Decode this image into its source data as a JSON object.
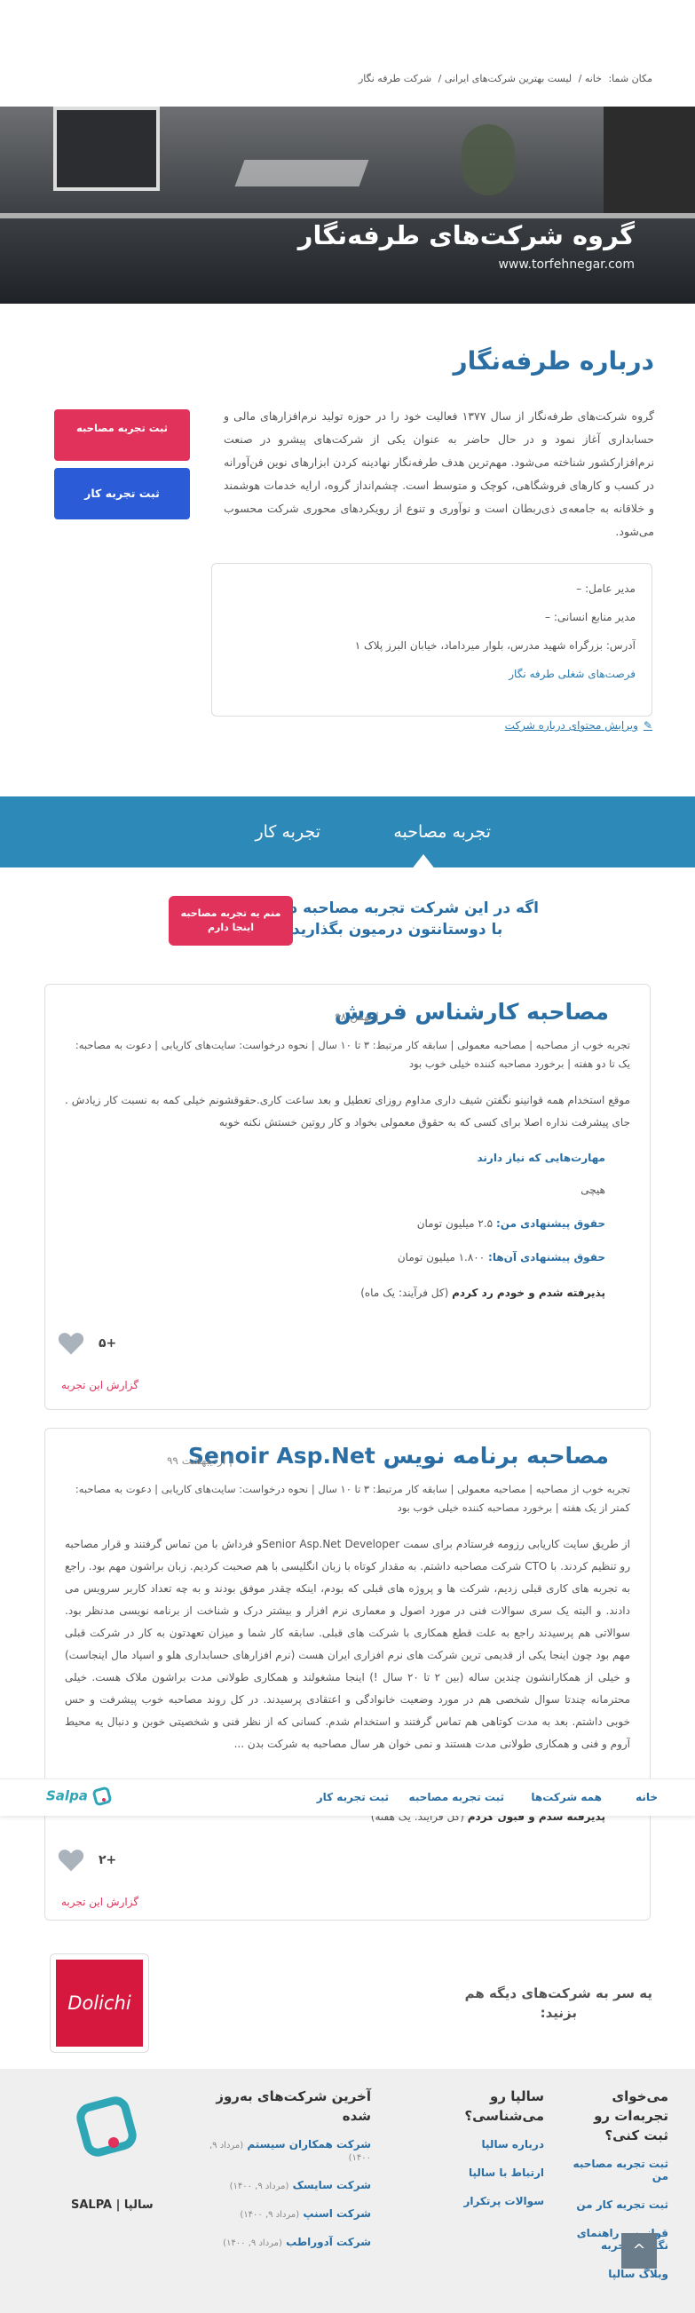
{
  "breadcrumb": {
    "prefix": "مکان شما:",
    "home": "خانه",
    "list": "لیست بهترین شرکت‌های ایرانی",
    "current": "شرکت طرفه نگار",
    "sep": "/"
  },
  "hero": {
    "title": "گروه شرکت‌های طرفه‌نگار",
    "website": "www.torfehnegar.com"
  },
  "about": {
    "title": "درباره طرفه‌نگار",
    "text": "گروه شرکت‌های طرفه‌نگار از سال ۱۳۷۷ فعالیت خود را در حوزه تولید نرم‌افزارهای مالی و حسابداری آغاز نمود و در حال حاضر به عنوان یکی از شرکت‌های پیشرو در صنعت نرم‌افزارکشور شناخته می‌شود. مهم‌ترین هدف طرفه‌نگار نهادینه کردن ابزارهای نوین فن‌آورانه در کسب و کارهای فروشگاهی، کوچک و متوسط است. چشم‌انداز گروه، ارایه خدمات هوشمند و خلاقانه به جامعه‌ی ذی‌ربطان است و نوآوری و تنوع از رویکردهای محوری شرکت محسوب می‌شود."
  },
  "buttons": {
    "add_interview": "ثبت تجربه مصاحبه",
    "add_work": "ثبت تجربه کار"
  },
  "info": {
    "ceo": "مدیر عامل: –",
    "hr": "مدیر منابع انسانی: –",
    "address": "آدرس: بزرگراه شهید مدرس، بلوار میرداماد، خیابان البرز پلاک ۱",
    "jobs": "فرصت‌های شغلی طرفه نگار",
    "edit": "ویرایش محتوای درباره شرکت"
  },
  "tabs": {
    "interview": "تجربه مصاحبه",
    "work": "تجربه کار"
  },
  "cta": {
    "line1": "اگه در این شرکت تجربه مصاحبه دارید،",
    "line2": "با دوستانتون درمیون بگذارید",
    "button": "منم یه تجربه مصاحبه اینجا دارم"
  },
  "reviews": [
    {
      "title": "مصاحبه کارشناس فروش",
      "date": "| بهمن ۹۸",
      "meta": "تجربه خوب از مصاحبه | مصاحبه معمولی | سابقه کار مرتبط: ۳ تا ۱۰ سال | نحوه درخواست: سایت‌های کاریابی | دعوت به مصاحبه: یک تا دو هفته | برخورد مصاحبه کننده خیلی خوب بود",
      "desc": "موقع استخدام همه قوانینو نگفتن شیف داری مداوم روزای تعطیل و بعد ساعت کاری.حقوقشونم خیلی کمه به نسبت کار زیادش . جای پیشرفت نداره اصلا برای کسی که به حقوق معمولی بخواد و کار روتین خستش نکنه خوبه",
      "skills_label": "مهارت‌هایی که نیاز دارند",
      "skills_value": "هیچی",
      "offer_label": "حقوق پیشنهادی من:",
      "offer_value": "۲.۵ میلیون تومان",
      "their_label": "حقوق پیشنهادی آن‌ها:",
      "their_value": "۱.۸۰۰ میلیون تومان",
      "result_label": "پذیرفته شدم و خودم رد کردم",
      "result_note": "(کل فرآیند: یک ماه)",
      "likes": "+۵",
      "report": "گزارش این تجربه"
    },
    {
      "title": "مصاحبه برنامه نویس Senoir Asp.Net",
      "date": "| اردیبهشت ۹۹",
      "meta": "تجربه خوب از مصاحبه | مصاحبه معمولی | سابقه کار مرتبط: ۳ تا ۱۰ سال | نحوه درخواست: سایت‌های کاریابی | دعوت به مصاحبه: کمتر از یک هفته | برخورد مصاحبه کننده خیلی خوب بود",
      "desc": "از طریق سایت کاریابی رزومه فرستادم برای سمت Senior Asp.Net Developerو فرداش با من تماس گرفتند و قرار مصاحبه رو تنظیم کردند. با CTO شرکت مصاحبه داشتم. به مقدار کوتاه با زبان انگلیسی با هم صحبت کردیم. زبان براشون مهم بود. راجع به تجربه های کاری قبلی زدیم، شرکت ها و پروژه های قبلی که بودم، اینکه چقدر موفق بودند و به چه تعداد کاربر سرویس می دادند. و البته یک سری سوالات فنی در مورد اصول و معماری نرم افزار و بیشتر درک و شناخت از برنامه نویسی مدنظر بود. سوالاتی هم پرسیدند راجع به علت قطع همکاری با شرکت های قبلی. سابقه کار شما و میزان تعهدتون به کار در شرکت قبلی مهم بود چون اینجا یکی از قدیمی ترین شرکت های نرم افزاری ایران هست (نرم افزارهای حسابداری هلو و اسپاد مال اینجاست) و خیلی از همکارانشون چندین ساله (بین ۲ تا ۲۰ سال !) اینجا مشغولند و همکاری طولانی مدت براشون ملاک هست. خیلی محترمانه چندتا سوال شخصی هم در مورد وضعیت خانوادگی و اعتقادی پرسیدند. در کل روند مصاحبه خوب پیشرفت و حس خوبی داشتم. بعد به مدت کوتاهی هم تماس گرفتند و استخدام شدم. کسانی که از نظر فنی و شخصیتی خوبن و دنبال یه محیط آروم و فنی و همکاری طولانی مدت هستند و نمی خوان هر سال مصاحبه به شرکت بدن ...",
      "result_label": "پذیرفته شدم و قبول کردم",
      "result_note": "(کل فرآیند: یک هفته)",
      "likes": "+۲",
      "report": "گزارش این تجربه"
    }
  ],
  "sticky_nav": {
    "home": "خانه",
    "companies": "همه شرکت‌ها",
    "add_interview": "ثبت تجربه مصاحبه",
    "add_work": "ثبت تجربه کار",
    "logo": "Salpa"
  },
  "other": {
    "text_line1": "یه سر به شرکت‌های دیگه هم",
    "text_line2": "بزنید:",
    "dolichi": "Dolichi"
  },
  "footer": {
    "col1_title": "می‌خوای تجربه‌ات رو ثبت کنی؟",
    "col1_links": [
      "ثبت تجربه مصاحبه من",
      "ثبت تجربه کار من",
      "قوانین و راهنمای نگارش تجربه",
      "وبلاگ سالپا"
    ],
    "col2_title": "سالپا رو می‌شناسی؟",
    "col2_links": [
      "درباره سالپا",
      "ارتباط با سالپا",
      "سوالات پرتکرار"
    ],
    "col3_title": "آخرین شرکت‌های به‌روز شده",
    "col3_items": [
      {
        "name": "شرکت همکاران سیستم",
        "date": "(مرداد ۹, ۱۴۰۰)"
      },
      {
        "name": "شرکت سایسک",
        "date": "(مرداد ۹, ۱۴۰۰)"
      },
      {
        "name": "شرکت اسنپ",
        "date": "(مرداد ۹, ۱۴۰۰)"
      },
      {
        "name": "شرکت آدوراطب",
        "date": "(مرداد ۹, ۱۴۰۰)"
      }
    ],
    "brand": "سالپا | SALPA",
    "to_top": "^"
  },
  "colors": {
    "primary_blue": "#2a6ea3",
    "tab_bar": "#2d8ab8",
    "accent_red": "#e0325a",
    "button_blue": "#2c5bd8"
  }
}
